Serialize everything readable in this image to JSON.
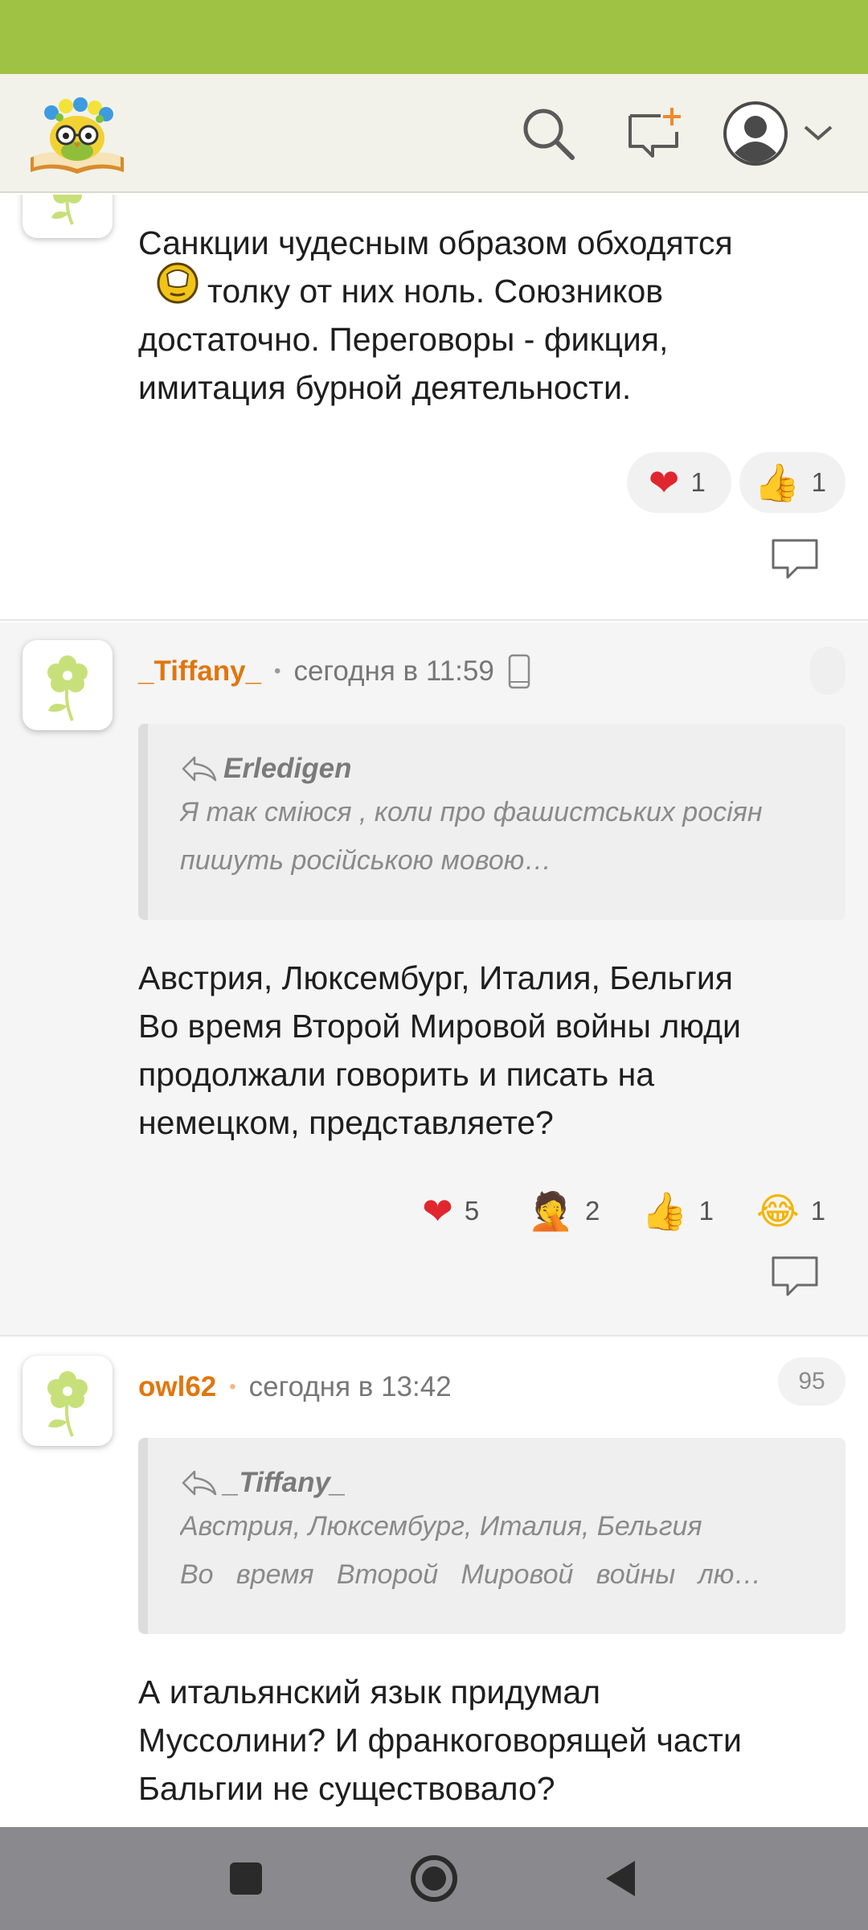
{
  "colors": {
    "accent_green": "#9fc244",
    "author_orange": "#e0760e",
    "header_bg": "#f2f2ea"
  },
  "header": {
    "logo": "owl-with-flower-wreath-on-book-logo",
    "icons": [
      "search-icon",
      "new-message-icon",
      "user-avatar-icon",
      "chevron-down-icon"
    ]
  },
  "comments": [
    {
      "text_line1": "Санкции чудесным образом обходятся",
      "text_line2": "толку от них ноль. Союзников",
      "text_line3": "достаточно. Переговоры - фикция,",
      "text_line4": "имитация бурной деятельности.",
      "inline_emoji": "facepalm-smiley-icon",
      "reactions": [
        {
          "emoji": "❤",
          "icon": "heart-icon",
          "count": "1"
        },
        {
          "emoji": "👍",
          "icon": "thumbs-up-icon",
          "count": "1"
        }
      ]
    },
    {
      "author": "_Tiffany_",
      "time": "сегодня в 11:59",
      "device_icon": "mobile-phone-icon",
      "quote": {
        "author": "Erledigen",
        "line1": "Я так сміюся , коли про фашистських росіян",
        "line2": "пишуть російською мовою…"
      },
      "text_line1": "Австрия, Люксембург, Италия, Бельгия",
      "text_line2": "Во время Второй Мировой войны люди",
      "text_line3": "продолжали говорить и писать на",
      "text_line4": "немецком, представляете?",
      "reactions": [
        {
          "emoji": "❤",
          "icon": "heart-icon",
          "count": "5"
        },
        {
          "emoji": "🤦",
          "icon": "facepalm-icon",
          "count": "2"
        },
        {
          "emoji": "👍",
          "icon": "thumbs-up-icon",
          "count": "1"
        },
        {
          "emoji": "😂",
          "icon": "tears-of-joy-icon",
          "count": "1"
        }
      ]
    },
    {
      "author": "owl62",
      "time": "сегодня в 13:42",
      "counter": "95",
      "quote": {
        "author": "_Tiffany_",
        "line1": "Австрия, Люксембург, Италия, Бельгия",
        "line2": "Во   время   Второй   Мировой   войны   лю…"
      },
      "text_line1": "А итальянский язык придумал",
      "text_line2": "Муссолини? И франкоговорящей части",
      "text_line3": "Бальгии не существовало?"
    }
  ],
  "navbar": {
    "icons": [
      "recent-apps-icon",
      "home-icon",
      "back-icon"
    ]
  }
}
